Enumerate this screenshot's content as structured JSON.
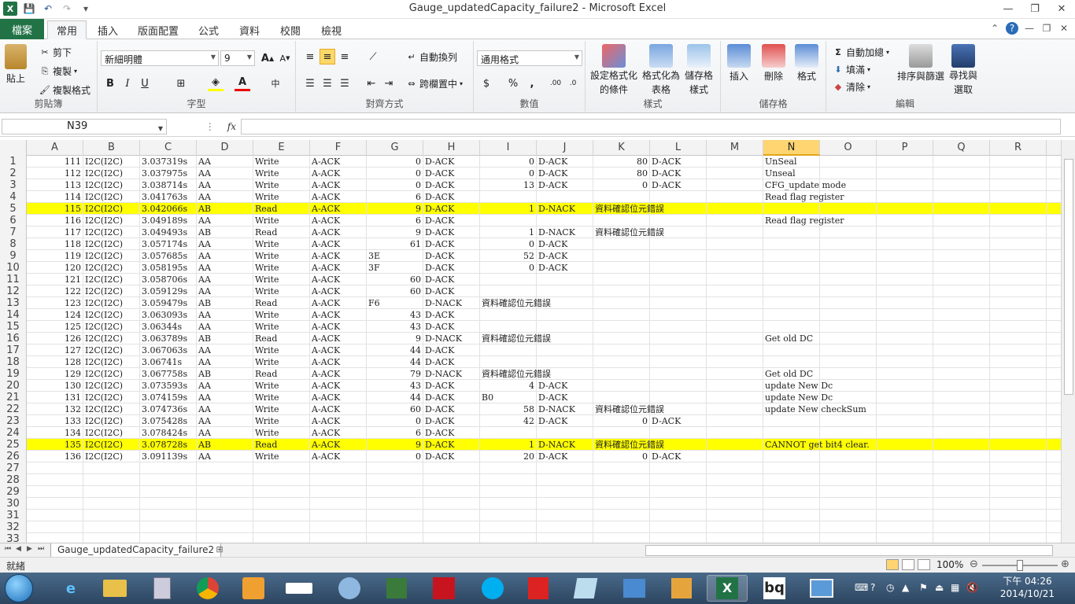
{
  "window": {
    "title": "Gauge_updatedCapacity_failure2 - Microsoft Excel"
  },
  "tabs": [
    "檔案",
    "常用",
    "插入",
    "版面配置",
    "公式",
    "資料",
    "校閱",
    "檢視"
  ],
  "ribbon": {
    "clipboard": {
      "paste": "貼上",
      "cut": "剪下",
      "copy": "複製",
      "format_painter": "複製格式",
      "label": "剪貼簿"
    },
    "font": {
      "name": "新細明體",
      "size": "9",
      "label": "字型"
    },
    "alignment": {
      "wrap": "自動換列",
      "merge": "跨欄置中",
      "label": "對齊方式"
    },
    "number": {
      "format": "通用格式",
      "label": "數值"
    },
    "styles": {
      "conditional": [
        "設定格式化",
        "的條件"
      ],
      "table": [
        "格式化為",
        "表格"
      ],
      "cell_styles": [
        "儲存格",
        "樣式"
      ],
      "label": "樣式"
    },
    "cells": {
      "insert": "插入",
      "delete": "刪除",
      "format": "格式",
      "label": "儲存格"
    },
    "editing": {
      "autosum": "自動加總",
      "fill": "填滿",
      "clear": "清除",
      "sort": "排序與篩選",
      "find": [
        "尋找與",
        "選取"
      ],
      "label": "編輯"
    }
  },
  "formula_bar": {
    "name_box": "N39",
    "fx": "fx",
    "value": ""
  },
  "columns": [
    "A",
    "B",
    "C",
    "D",
    "E",
    "F",
    "G",
    "H",
    "I",
    "J",
    "K",
    "L",
    "M",
    "N",
    "O",
    "P",
    "Q",
    "R"
  ],
  "selected_column": "N",
  "rows": [
    {
      "n": "1",
      "A": "111",
      "B": "I2C(I2C)",
      "C": "3.037319s",
      "D": "AA",
      "E": "Write",
      "F": "A-ACK",
      "G": "0",
      "H": "D-ACK",
      "I": "0",
      "J": "D-ACK",
      "K": "80",
      "L": "D-ACK",
      "N": "UnSeal"
    },
    {
      "n": "2",
      "A": "112",
      "B": "I2C(I2C)",
      "C": "3.037975s",
      "D": "AA",
      "E": "Write",
      "F": "A-ACK",
      "G": "0",
      "H": "D-ACK",
      "I": "0",
      "J": "D-ACK",
      "K": "80",
      "L": "D-ACK",
      "N": "Unseal"
    },
    {
      "n": "3",
      "A": "113",
      "B": "I2C(I2C)",
      "C": "3.038714s",
      "D": "AA",
      "E": "Write",
      "F": "A-ACK",
      "G": "0",
      "H": "D-ACK",
      "I": "13",
      "J": "D-ACK",
      "K": "0",
      "L": "D-ACK",
      "N": "CFG_update mode"
    },
    {
      "n": "4",
      "A": "114",
      "B": "I2C(I2C)",
      "C": "3.041763s",
      "D": "AA",
      "E": "Write",
      "F": "A-ACK",
      "G": "6",
      "H": "D-ACK",
      "N": "Read flag register"
    },
    {
      "n": "5",
      "hl": true,
      "A": "115",
      "B": "I2C(I2C)",
      "C": "3.042066s",
      "D": "AB",
      "E": "Read",
      "F": "A-ACK",
      "G": "9",
      "H": "D-ACK",
      "I": "1",
      "J": "D-NACK",
      "K": "資料確認位元錯誤"
    },
    {
      "n": "6",
      "A": "116",
      "B": "I2C(I2C)",
      "C": "3.049189s",
      "D": "AA",
      "E": "Write",
      "F": "A-ACK",
      "G": "6",
      "H": "D-ACK",
      "N": "Read flag register"
    },
    {
      "n": "7",
      "A": "117",
      "B": "I2C(I2C)",
      "C": "3.049493s",
      "D": "AB",
      "E": "Read",
      "F": "A-ACK",
      "G": "9",
      "H": "D-ACK",
      "I": "1",
      "J": "D-NACK",
      "K": "資料確認位元錯誤"
    },
    {
      "n": "8",
      "A": "118",
      "B": "I2C(I2C)",
      "C": "3.057174s",
      "D": "AA",
      "E": "Write",
      "F": "A-ACK",
      "G": "61",
      "H": "D-ACK",
      "I": "0",
      "J": "D-ACK"
    },
    {
      "n": "9",
      "A": "119",
      "B": "I2C(I2C)",
      "C": "3.057685s",
      "D": "AA",
      "E": "Write",
      "F": "A-ACK",
      "Gl": "3E",
      "H": "D-ACK",
      "I": "52",
      "J": "D-ACK"
    },
    {
      "n": "10",
      "A": "120",
      "B": "I2C(I2C)",
      "C": "3.058195s",
      "D": "AA",
      "E": "Write",
      "F": "A-ACK",
      "Gl": "3F",
      "H": "D-ACK",
      "I": "0",
      "J": "D-ACK"
    },
    {
      "n": "11",
      "A": "121",
      "B": "I2C(I2C)",
      "C": "3.058706s",
      "D": "AA",
      "E": "Write",
      "F": "A-ACK",
      "G": "60",
      "H": "D-ACK"
    },
    {
      "n": "12",
      "A": "122",
      "B": "I2C(I2C)",
      "C": "3.059129s",
      "D": "AA",
      "E": "Write",
      "F": "A-ACK",
      "G": "60",
      "H": "D-ACK"
    },
    {
      "n": "13",
      "A": "123",
      "B": "I2C(I2C)",
      "C": "3.059479s",
      "D": "AB",
      "E": "Read",
      "F": "A-ACK",
      "Gl": "F6",
      "H": "D-NACK",
      "Il": "資料確認位元錯誤"
    },
    {
      "n": "14",
      "A": "124",
      "B": "I2C(I2C)",
      "C": "3.063093s",
      "D": "AA",
      "E": "Write",
      "F": "A-ACK",
      "G": "43",
      "H": "D-ACK"
    },
    {
      "n": "15",
      "A": "125",
      "B": "I2C(I2C)",
      "C": "3.06344s",
      "D": "AA",
      "E": "Write",
      "F": "A-ACK",
      "G": "43",
      "H": "D-ACK"
    },
    {
      "n": "16",
      "A": "126",
      "B": "I2C(I2C)",
      "C": "3.063789s",
      "D": "AB",
      "E": "Read",
      "F": "A-ACK",
      "G": "9",
      "H": "D-NACK",
      "Il": "資料確認位元錯誤",
      "N": "Get old DC"
    },
    {
      "n": "17",
      "A": "127",
      "B": "I2C(I2C)",
      "C": "3.067063s",
      "D": "AA",
      "E": "Write",
      "F": "A-ACK",
      "G": "44",
      "H": "D-ACK"
    },
    {
      "n": "18",
      "A": "128",
      "B": "I2C(I2C)",
      "C": "3.06741s",
      "D": "AA",
      "E": "Write",
      "F": "A-ACK",
      "G": "44",
      "H": "D-ACK"
    },
    {
      "n": "19",
      "A": "129",
      "B": "I2C(I2C)",
      "C": "3.067758s",
      "D": "AB",
      "E": "Read",
      "F": "A-ACK",
      "G": "79",
      "H": "D-NACK",
      "Il": "資料確認位元錯誤",
      "N": "Get old DC"
    },
    {
      "n": "20",
      "A": "130",
      "B": "I2C(I2C)",
      "C": "3.073593s",
      "D": "AA",
      "E": "Write",
      "F": "A-ACK",
      "G": "43",
      "H": "D-ACK",
      "I": "4",
      "J": "D-ACK",
      "N": "update New Dc"
    },
    {
      "n": "21",
      "A": "131",
      "B": "I2C(I2C)",
      "C": "3.074159s",
      "D": "AA",
      "E": "Write",
      "F": "A-ACK",
      "G": "44",
      "H": "D-ACK",
      "Il": "B0",
      "J": "D-ACK",
      "N": "update New Dc"
    },
    {
      "n": "22",
      "A": "132",
      "B": "I2C(I2C)",
      "C": "3.074736s",
      "D": "AA",
      "E": "Write",
      "F": "A-ACK",
      "G": "60",
      "H": "D-ACK",
      "I": "58",
      "J": "D-NACK",
      "K": "資料確認位元錯誤",
      "N": "update New checkSum"
    },
    {
      "n": "23",
      "A": "133",
      "B": "I2C(I2C)",
      "C": "3.075428s",
      "D": "AA",
      "E": "Write",
      "F": "A-ACK",
      "G": "0",
      "H": "D-ACK",
      "I": "42",
      "J": "D-ACK",
      "Kr": "0",
      "L": "D-ACK"
    },
    {
      "n": "24",
      "A": "134",
      "B": "I2C(I2C)",
      "C": "3.078424s",
      "D": "AA",
      "E": "Write",
      "F": "A-ACK",
      "G": "6",
      "H": "D-ACK"
    },
    {
      "n": "25",
      "hl": true,
      "A": "135",
      "B": "I2C(I2C)",
      "C": "3.078728s",
      "D": "AB",
      "E": "Read",
      "F": "A-ACK",
      "G": "9",
      "H": "D-ACK",
      "I": "1",
      "J": "D-NACK",
      "K": "資料確認位元錯誤",
      "N": "CANNOT get bit4 clear."
    },
    {
      "n": "26",
      "A": "136",
      "B": "I2C(I2C)",
      "C": "3.091139s",
      "D": "AA",
      "E": "Write",
      "F": "A-ACK",
      "G": "0",
      "H": "D-ACK",
      "I": "20",
      "J": "D-ACK",
      "Kr": "0",
      "L": "D-ACK"
    },
    {
      "n": "27"
    },
    {
      "n": "28"
    },
    {
      "n": "29"
    },
    {
      "n": "30"
    },
    {
      "n": "31"
    },
    {
      "n": "32"
    },
    {
      "n": "33"
    }
  ],
  "sheet_tab": "Gauge_updatedCapacity_failure2",
  "status": {
    "text": "就緒",
    "zoom": "100%"
  },
  "clock": {
    "time": "下午 04:26",
    "date": "2014/10/21"
  }
}
